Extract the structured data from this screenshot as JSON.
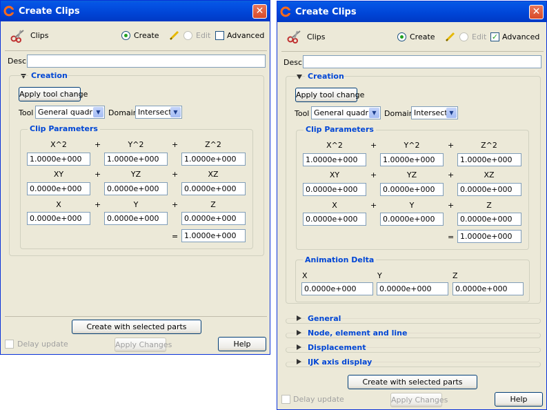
{
  "left": {
    "title": "Create Clips",
    "close": "✕",
    "clips_label": "Clips",
    "mode_create": "Create",
    "mode_edit": "Edit",
    "advanced": "Advanced",
    "advanced_checked": false,
    "desc_label": "Desc.",
    "desc_value": "",
    "creation_header": "Creation",
    "apply_tool_change": "Apply tool change",
    "tool_label": "Tool",
    "tool_value": "General quadric",
    "domain_label": "Domain",
    "domain_value": "Intersect",
    "clip_params_title": "Clip Parameters",
    "row1_labels": [
      "X^2",
      "Y^2",
      "Z^2"
    ],
    "row1_values": [
      "1.0000e+000",
      "1.0000e+000",
      "1.0000e+000"
    ],
    "row2_labels": [
      "XY",
      "YZ",
      "XZ"
    ],
    "row2_values": [
      "0.0000e+000",
      "0.0000e+000",
      "0.0000e+000"
    ],
    "row3_labels": [
      "X",
      "Y",
      "Z"
    ],
    "row3_values": [
      "0.0000e+000",
      "0.0000e+000",
      "0.0000e+000"
    ],
    "plus": "+",
    "equals": "=",
    "rhs_value": "1.0000e+000",
    "create_button": "Create with selected parts",
    "delay_update": "Delay update",
    "apply_changes": "Apply Changes",
    "help": "Help"
  },
  "right": {
    "title": "Create Clips",
    "close": "✕",
    "clips_label": "Clips",
    "mode_create": "Create",
    "mode_edit": "Edit",
    "advanced": "Advanced",
    "advanced_checked": true,
    "check_mark": "✓",
    "desc_label": "Desc.",
    "desc_value": "",
    "creation_header": "Creation",
    "apply_tool_change": "Apply tool change",
    "tool_label": "Tool",
    "tool_value": "General quadric",
    "domain_label": "Domain",
    "domain_value": "Intersect",
    "clip_params_title": "Clip Parameters",
    "row1_labels": [
      "X^2",
      "Y^2",
      "Z^2"
    ],
    "row1_values": [
      "1.0000e+000",
      "1.0000e+000",
      "1.0000e+000"
    ],
    "row2_labels": [
      "XY",
      "YZ",
      "XZ"
    ],
    "row2_values": [
      "0.0000e+000",
      "0.0000e+000",
      "0.0000e+000"
    ],
    "row3_labels": [
      "X",
      "Y",
      "Z"
    ],
    "row3_values": [
      "0.0000e+000",
      "0.0000e+000",
      "0.0000e+000"
    ],
    "plus": "+",
    "equals": "=",
    "rhs_value": "1.0000e+000",
    "animation_delta_title": "Animation Delta",
    "anim_labels": [
      "X",
      "Y",
      "Z"
    ],
    "anim_values": [
      "0.0000e+000",
      "0.0000e+000",
      "0.0000e+000"
    ],
    "sections": [
      "General",
      "Node, element and line",
      "Displacement",
      "IJK axis display"
    ],
    "create_button": "Create with selected parts",
    "delay_update": "Delay update",
    "apply_changes": "Apply Changes",
    "help": "Help"
  },
  "colors": {
    "title_bar": "#0054e3",
    "window_bg": "#ece9d8",
    "group_title": "#0046d5",
    "close_button": "#d84a28"
  }
}
